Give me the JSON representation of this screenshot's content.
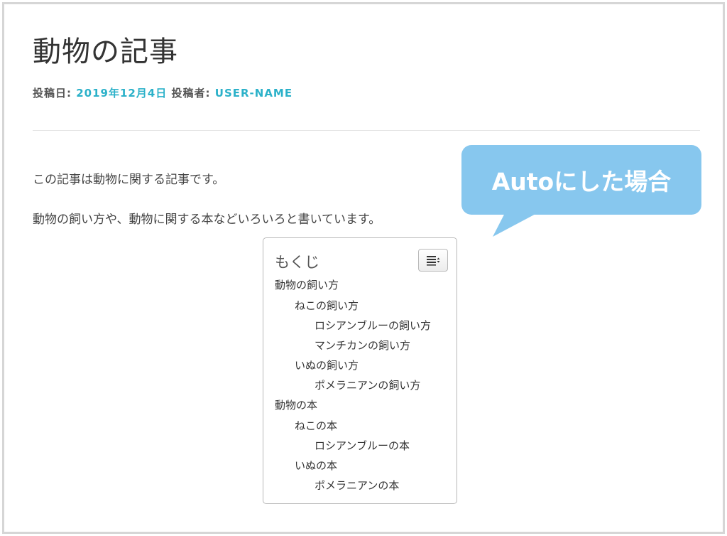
{
  "article": {
    "title": "動物の記事",
    "meta": {
      "date_label": "投稿日:",
      "date": "2019年12月4日",
      "author_label": "投稿者:",
      "author": "USER-NAME"
    },
    "paragraphs": [
      "この記事は動物に関する記事です。",
      "動物の飼い方や、動物に関する本などいろいろと書いています。"
    ]
  },
  "toc": {
    "title": "もくじ",
    "toggle_icon": "list-toggle-icon",
    "items": [
      {
        "label": "動物の飼い方",
        "level": 1
      },
      {
        "label": "ねこの飼い方",
        "level": 2
      },
      {
        "label": "ロシアンブルーの飼い方",
        "level": 3
      },
      {
        "label": "マンチカンの飼い方",
        "level": 3
      },
      {
        "label": "いぬの飼い方",
        "level": 2
      },
      {
        "label": "ポメラニアンの飼い方",
        "level": 3
      },
      {
        "label": "動物の本",
        "level": 1
      },
      {
        "label": "ねこの本",
        "level": 2
      },
      {
        "label": "ロシアンブルーの本",
        "level": 3
      },
      {
        "label": "いぬの本",
        "level": 2
      },
      {
        "label": "ポメラニアンの本",
        "level": 3
      }
    ]
  },
  "callout": {
    "text": "Autoにした場合",
    "color": "#87c7ee"
  },
  "colors": {
    "link": "#2bb1c9",
    "text": "#333333",
    "border": "#d6d6d6"
  }
}
